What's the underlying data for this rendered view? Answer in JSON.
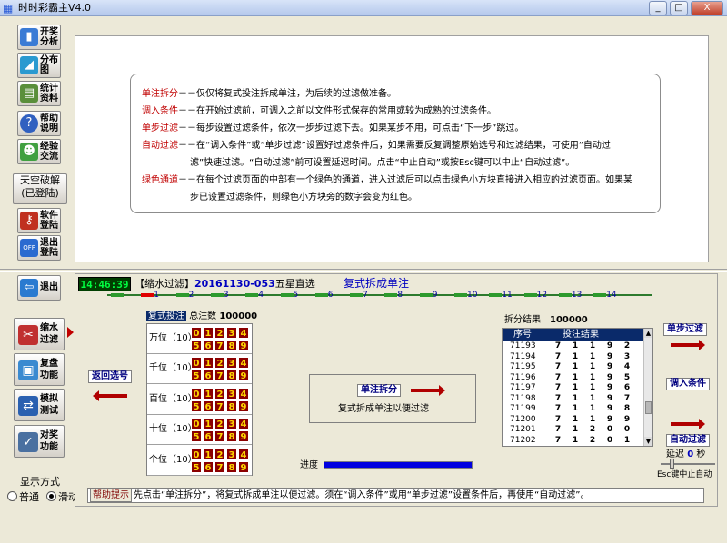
{
  "window": {
    "title": "时时彩霸主V4.0",
    "minimize": "_",
    "maximize": "□",
    "close": "X"
  },
  "nav": {
    "lottery_analysis": [
      "开奖",
      "分析"
    ],
    "distribution": [
      "分布",
      "图"
    ],
    "statistics": [
      "统计",
      "资料"
    ],
    "help": [
      "帮助",
      "说明"
    ],
    "experience": [
      "经验",
      "交流"
    ],
    "crack": [
      "天空破解",
      "(已登陆)"
    ],
    "software_login": [
      "软件",
      "登陆"
    ],
    "logout": [
      "退出",
      "登陆"
    ],
    "exit": "退出"
  },
  "description": [
    {
      "key": "单注拆分",
      "text": "－－仅仅将复式投注拆成单注，为后续的过滤做准备。"
    },
    {
      "key": "调入条件",
      "text": "－－在开始过滤前，可调入之前以文件形式保存的常用或较为成熟的过滤条件。"
    },
    {
      "key": "单步过滤",
      "text": "－－每步设置过滤条件，依次一步步过滤下去。如果某步不用，可点击“下一步”跳过。"
    },
    {
      "key": "自动过滤",
      "text": "－－在“调入条件”或“单步过滤”设置好过滤条件后，如果需要反复调整原始选号和过滤结果，可使用“自动过",
      "cont": "滤”快速过滤。“自动过滤”前可设置延迟时间。点击“中止自动”或按Esc键可以中止“自动过滤”。"
    },
    {
      "key": "绿色通道",
      "text": "－－在每个过滤页面的中部有一个绿色的通道，进入过滤后可以点击绿色小方块直接进入相应的过滤页面。如果某",
      "cont": "步已设置过滤条件，则绿色小方块旁的数字会变为红色。"
    }
  ],
  "tools": {
    "shrink_filter": [
      "缩水",
      "过滤"
    ],
    "review": [
      "复盘",
      "功能"
    ],
    "simulate": [
      "模拟",
      "测试"
    ],
    "award_check": [
      "对奖",
      "功能"
    ]
  },
  "display_mode": {
    "label": "显示方式",
    "normal": "普通",
    "scroll": "滑动",
    "selected": "scroll"
  },
  "status": {
    "clock": "14:46:39",
    "filter_prefix": "【缩水过滤】",
    "filter_code": "20161130-053",
    "filter_type": "五星直选",
    "mode_title": "复式拆成单注"
  },
  "channels": [
    "1",
    "2",
    "3",
    "4",
    "5",
    "6",
    "7",
    "8",
    "9",
    "10",
    "11",
    "12",
    "13",
    "14"
  ],
  "grid": {
    "tag": "复式投注",
    "total_label": "总注数",
    "total": "100000",
    "positions": [
      {
        "label": "万位（10）",
        "digits": [
          "0",
          "1",
          "2",
          "3",
          "4",
          "5",
          "6",
          "7",
          "8",
          "9"
        ]
      },
      {
        "label": "千位（10）",
        "digits": [
          "0",
          "1",
          "2",
          "3",
          "4",
          "5",
          "6",
          "7",
          "8",
          "9"
        ]
      },
      {
        "label": "百位（10）",
        "digits": [
          "0",
          "1",
          "2",
          "3",
          "4",
          "5",
          "6",
          "7",
          "8",
          "9"
        ]
      },
      {
        "label": "十位（10）",
        "digits": [
          "0",
          "1",
          "2",
          "3",
          "4",
          "5",
          "6",
          "7",
          "8",
          "9"
        ]
      },
      {
        "label": "个位（10）",
        "digits": [
          "0",
          "1",
          "2",
          "3",
          "4",
          "5",
          "6",
          "7",
          "8",
          "9"
        ]
      }
    ]
  },
  "buttons": {
    "back": "返回选号",
    "split": "单注拆分",
    "split_note": "复式拆成单注以便过滤",
    "step_filter": "单步过滤",
    "load_conditions": "调入条件",
    "auto_filter": "自动过滤"
  },
  "progress": {
    "label": "进度",
    "value": 1.0,
    "color": "#0000e0"
  },
  "result": {
    "label": "拆分结果",
    "count": "100000",
    "columns": [
      "序号",
      "投注结果"
    ],
    "rows": [
      {
        "id": "71193",
        "digits": [
          "7",
          "1",
          "1",
          "9",
          "2"
        ]
      },
      {
        "id": "71194",
        "digits": [
          "7",
          "1",
          "1",
          "9",
          "3"
        ]
      },
      {
        "id": "71195",
        "digits": [
          "7",
          "1",
          "1",
          "9",
          "4"
        ]
      },
      {
        "id": "71196",
        "digits": [
          "7",
          "1",
          "1",
          "9",
          "5"
        ]
      },
      {
        "id": "71197",
        "digits": [
          "7",
          "1",
          "1",
          "9",
          "6"
        ]
      },
      {
        "id": "71198",
        "digits": [
          "7",
          "1",
          "1",
          "9",
          "7"
        ]
      },
      {
        "id": "71199",
        "digits": [
          "7",
          "1",
          "1",
          "9",
          "8"
        ]
      },
      {
        "id": "71200",
        "digits": [
          "7",
          "1",
          "1",
          "9",
          "9"
        ]
      },
      {
        "id": "71201",
        "digits": [
          "7",
          "1",
          "2",
          "0",
          "0"
        ]
      },
      {
        "id": "71202",
        "digits": [
          "7",
          "1",
          "2",
          "0",
          "1"
        ]
      }
    ]
  },
  "delay": {
    "label": "延迟",
    "value": "0",
    "unit": "秒",
    "esc_note": "Esc键中止自动"
  },
  "help": {
    "tag": "帮助提示",
    "text": "先点击“单注拆分”，将复式拆成单注以便过滤。须在“调入条件”或用“单步过滤”设置条件后，再使用“自动过滤”。"
  },
  "colors": {
    "accent_red": "#c00000",
    "navy": "#0a2a6a",
    "digit_bg": "#8b0000",
    "digit_fg": "#ffd800",
    "channel_green": "#2d9a2d"
  }
}
